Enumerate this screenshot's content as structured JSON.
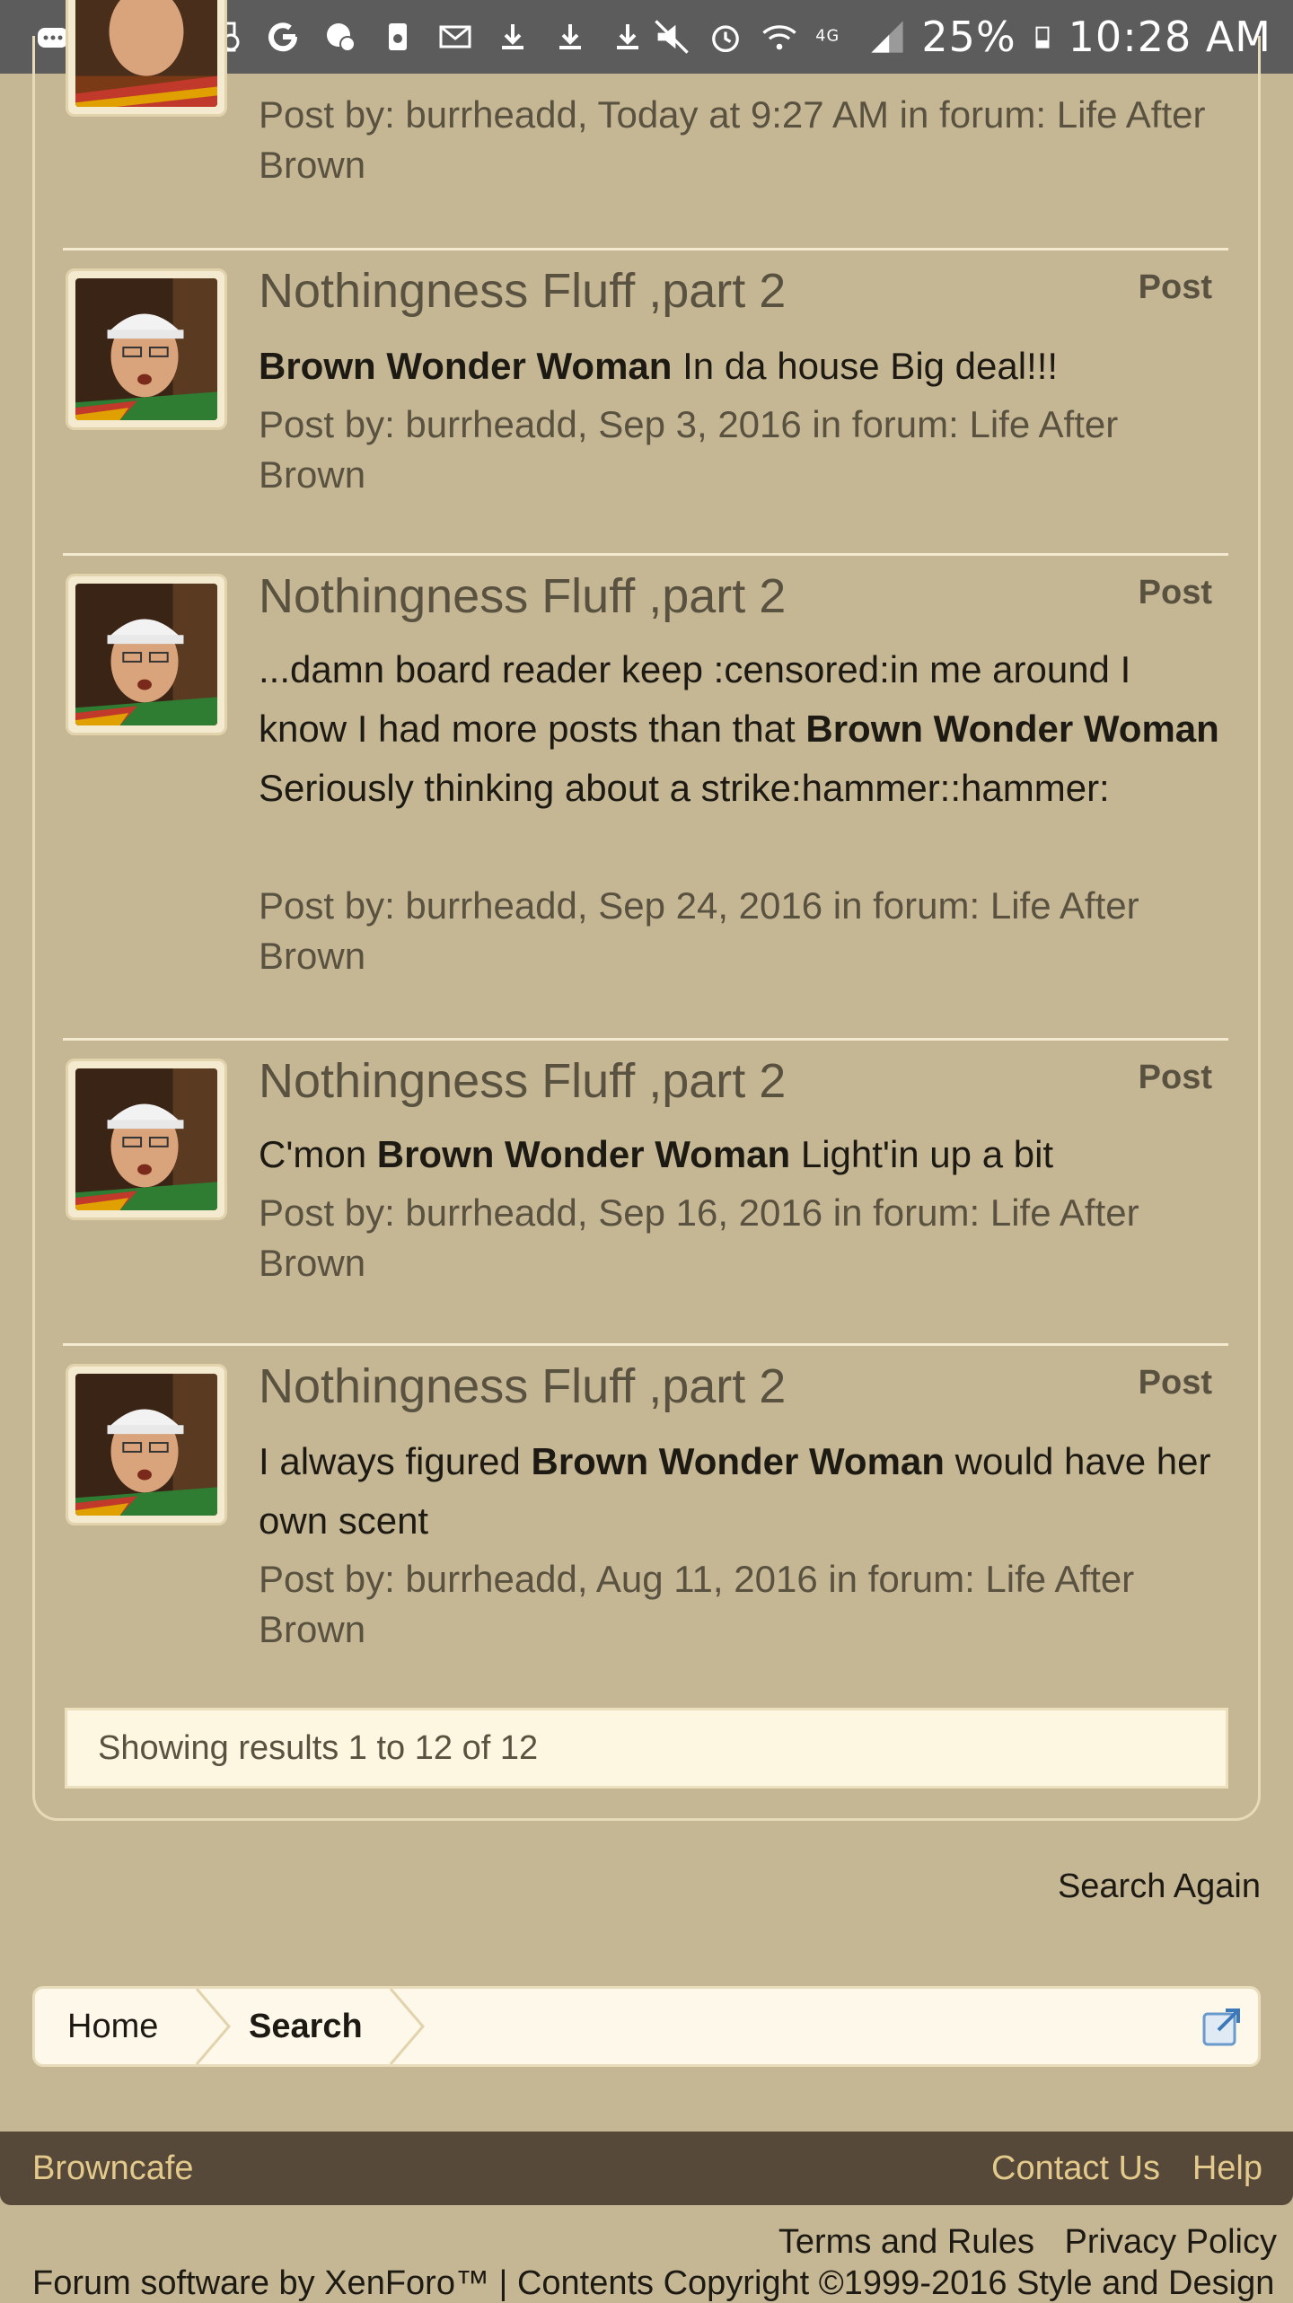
{
  "status_bar": {
    "icons": [
      "more-icon",
      "email-icon",
      "image-icon",
      "sync-icon",
      "google-icon",
      "chat-icon",
      "recycle-icon",
      "gmail-icon",
      "download-icon",
      "download-icon",
      "download-icon"
    ],
    "status_icons": [
      "mute-icon",
      "alarm-icon",
      "wifi-icon",
      "lte-icon",
      "signal-icon"
    ],
    "battery": "25%",
    "time": "10:28 AM"
  },
  "results": [
    {
      "title": "",
      "type": "",
      "snippet_parts": [],
      "meta": "Post by: burrheadd, Today at 9:27 AM in forum: Life After Brown"
    },
    {
      "title": "Nothingness Fluff ,part 2",
      "type": "Post",
      "snippet_parts": [
        {
          "bold": true,
          "text": "Brown Wonder Woman"
        },
        {
          "bold": false,
          "text": " In da house Big deal!!!"
        }
      ],
      "meta": "Post by: burrheadd, Sep 3, 2016 in forum: Life After Brown"
    },
    {
      "title": "Nothingness Fluff ,part 2",
      "type": "Post",
      "snippet_parts": [
        {
          "bold": false,
          "text": "...damn board reader keep :censored:in me around I know I had more posts than that "
        },
        {
          "bold": true,
          "text": "Brown Wonder Woman"
        },
        {
          "bold": false,
          "text": " Seriously thinking about a strike:hammer::hammer:"
        }
      ],
      "meta": "Post by: burrheadd, Sep 24, 2016 in forum: Life After Brown"
    },
    {
      "title": "Nothingness Fluff ,part 2",
      "type": "Post",
      "snippet_parts": [
        {
          "bold": false,
          "text": "C'mon "
        },
        {
          "bold": true,
          "text": "Brown Wonder Woman"
        },
        {
          "bold": false,
          "text": " Light'in up a bit"
        }
      ],
      "meta": "Post by: burrheadd, Sep 16, 2016 in forum: Life After Brown"
    },
    {
      "title": "Nothingness Fluff ,part 2",
      "type": "Post",
      "snippet_parts": [
        {
          "bold": false,
          "text": "I always figured "
        },
        {
          "bold": true,
          "text": "Brown Wonder Woman"
        },
        {
          "bold": false,
          "text": " would have her own scent"
        }
      ],
      "meta": "Post by: burrheadd, Aug 11, 2016 in forum: Life After Brown"
    }
  ],
  "results_count": "Showing results 1 to 12 of 12",
  "search_again": "Search Again",
  "breadcrumb": {
    "home": "Home",
    "search": "Search"
  },
  "footer": {
    "brand": "Browncafe",
    "contact": "Contact Us",
    "help": "Help",
    "terms": "Terms and Rules",
    "privacy": "Privacy Policy",
    "copyright": "Forum software by XenForo™ | Contents Copyright ©1999-2016 Style and Design"
  },
  "colors": {
    "background": "#c6b794",
    "footer_bg": "#56493a",
    "footer_link": "#e3c98c",
    "status_bar": "#5c5c5c"
  }
}
